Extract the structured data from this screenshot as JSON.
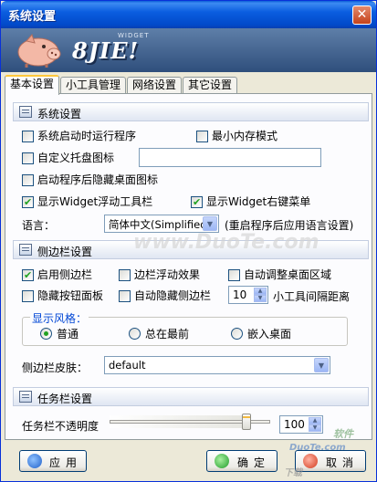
{
  "window": {
    "title": "系统设置"
  },
  "banner": {
    "logo_text": "8JIE!",
    "logo_sub": "WIDGET"
  },
  "tabs": [
    {
      "label": "基本设置",
      "active": true
    },
    {
      "label": "小工具管理",
      "active": false
    },
    {
      "label": "网络设置",
      "active": false
    },
    {
      "label": "其它设置",
      "active": false
    }
  ],
  "system": {
    "title": "系统设置",
    "run_on_startup": {
      "label": "系统启动时运行程序",
      "checked": false
    },
    "min_memory": {
      "label": "最小内存模式",
      "checked": false
    },
    "custom_tray": {
      "label": "自定义托盘图标",
      "checked": false,
      "value": ""
    },
    "hide_desktop_icons": {
      "label": "启动程序后隐藏桌面图标",
      "checked": false
    },
    "show_float_toolbar": {
      "label": "显示Widget浮动工具栏",
      "checked": true
    },
    "show_context_menu": {
      "label": "显示Widget右键菜单",
      "checked": true
    },
    "language_label": "语言：",
    "language_value": "简体中文(Simplified)",
    "language_note": "(重启程序后应用语言设置)"
  },
  "sidebar": {
    "title": "侧边栏设置",
    "enable": {
      "label": "启用侧边栏",
      "checked": true
    },
    "float_effect": {
      "label": "边栏浮动效果",
      "checked": false
    },
    "auto_adjust": {
      "label": "自动调整桌面区域",
      "checked": false
    },
    "hide_button_panel": {
      "label": "隐藏按钮面板",
      "checked": false
    },
    "auto_hide": {
      "label": "自动隐藏侧边栏",
      "checked": false
    },
    "spacing_value": "10",
    "spacing_label": "小工具间隔距离",
    "style_title": "显示风格：",
    "styles": [
      {
        "label": "普通",
        "selected": true
      },
      {
        "label": "总在最前",
        "selected": false
      },
      {
        "label": "嵌入桌面",
        "selected": false
      }
    ],
    "skin_label": "侧边栏皮肤：",
    "skin_value": "default"
  },
  "taskbar": {
    "title": "任务栏设置",
    "opacity_label": "任务栏不透明度",
    "opacity_value": "100",
    "opacity_fraction": 0.85
  },
  "buttons": {
    "apply": "应用",
    "ok": "确定",
    "cancel": "取消"
  },
  "colors": {
    "title_bar": "#0149c9",
    "banner": "#2f4f7c",
    "check": "#21a121",
    "group_title": "#0046d5"
  },
  "watermark": {
    "main": "www.DuoTe.com",
    "corner_1": "软件",
    "corner_2": "DuoTe.com",
    "corner_3": "下载"
  }
}
